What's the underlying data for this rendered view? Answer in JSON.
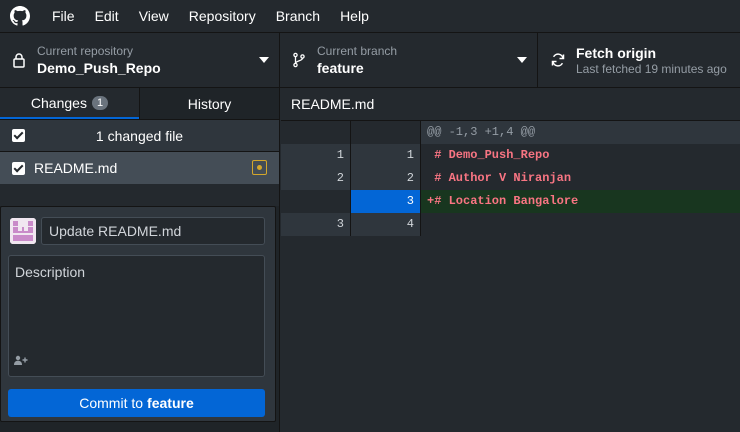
{
  "menu": {
    "items": [
      "File",
      "Edit",
      "View",
      "Repository",
      "Branch",
      "Help"
    ]
  },
  "toolbar": {
    "repo_sub": "Current repository",
    "repo_name": "Demo_Push_Repo",
    "branch_sub": "Current branch",
    "branch_name": "feature",
    "fetch_title": "Fetch origin",
    "fetch_sub": "Last fetched 19 minutes ago"
  },
  "tabs": {
    "changes_label": "Changes",
    "changes_count": "1",
    "history_label": "History"
  },
  "changes": {
    "header": "1 changed file",
    "files": [
      {
        "name": "README.md",
        "status": "modified"
      }
    ]
  },
  "commit": {
    "summary_placeholder": "Update README.md",
    "description_placeholder": "Description",
    "button_prefix": "Commit to",
    "button_branch": "feature"
  },
  "diff": {
    "file_name": "README.md",
    "hunk": "@@ -1,3 +1,4 @@",
    "lines": [
      {
        "old": "1",
        "new": "1",
        "text": " # Demo_Push_Repo",
        "type": "context"
      },
      {
        "old": "2",
        "new": "2",
        "text": " # Author V Niranjan",
        "type": "context"
      },
      {
        "old": "",
        "new": "3",
        "text": "+# Location Bangalore",
        "type": "added"
      },
      {
        "old": "3",
        "new": "4",
        "text": "",
        "type": "context"
      }
    ]
  },
  "colors": {
    "accent": "#0366d6",
    "modified": "#d4a72c",
    "added_bg": "#18361f",
    "diff_text": "#f97583"
  }
}
